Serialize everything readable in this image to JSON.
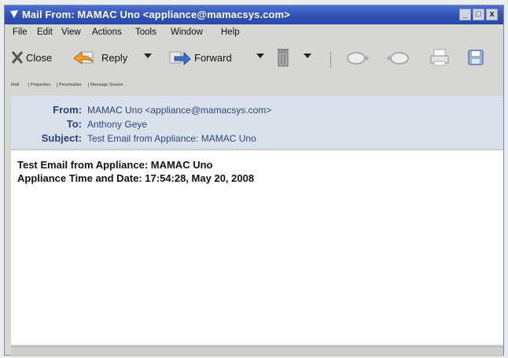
{
  "window": {
    "title": "Mail From: MAMAC Uno <appliance@mamacsys.com>"
  },
  "menu": [
    "File",
    "Edit",
    "View",
    "Actions",
    "Tools",
    "Window",
    "Help"
  ],
  "toolbar": {
    "close": "Close",
    "reply": "Reply",
    "forward": "Forward"
  },
  "tabs": [
    "Mail",
    "Properties",
    "Personalize",
    "Message Source"
  ],
  "header": {
    "from_label": "From:",
    "from": "MAMAC Uno <appliance@mamacsys.com>",
    "to_label": "To:",
    "to": "Anthony Geye",
    "subject_label": "Subject:",
    "subject": "Test Email from Appliance: MAMAC Uno"
  },
  "body": {
    "line1": "Test Email from Appliance: MAMAC Uno",
    "line2": "Appliance Time and Date: 17:54:28, May 20, 2008"
  }
}
